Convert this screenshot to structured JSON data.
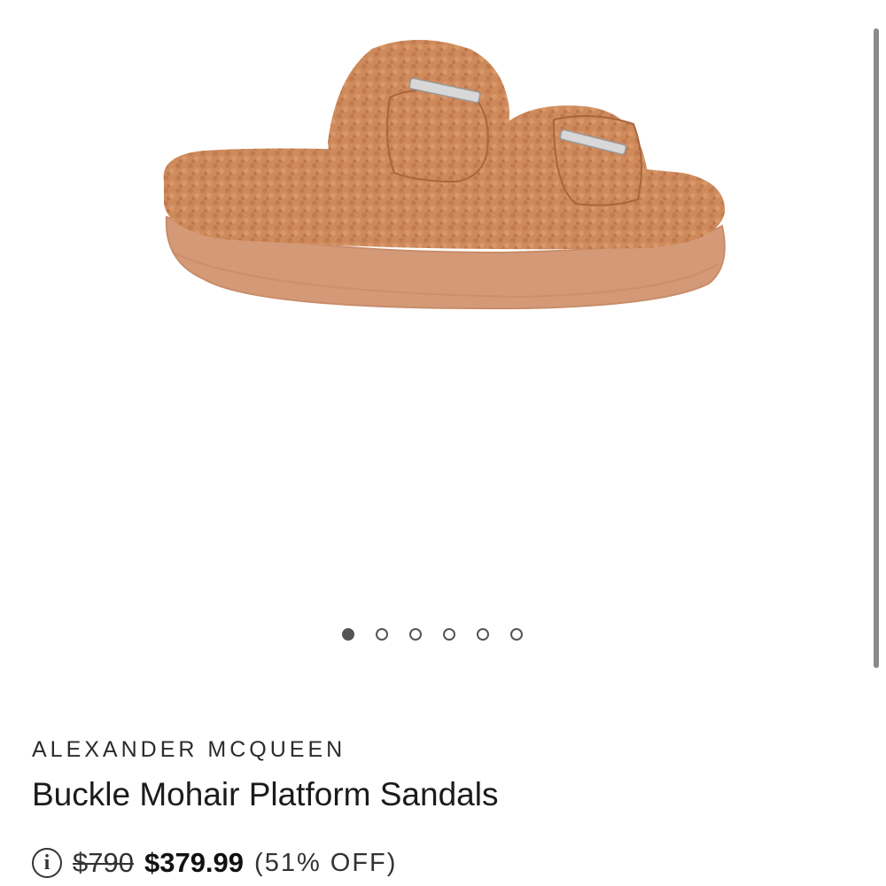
{
  "product": {
    "brand": "ALEXANDER MCQUEEN",
    "name": "Buckle Mohair Platform Sandals",
    "price": {
      "original": "$790",
      "sale": "$379.99",
      "discount": "(51% OFF)"
    },
    "image_alt_colors": {
      "sole": "#d49a78",
      "fur": "#cf8a5c",
      "fur_shadow": "#b56f45",
      "buckle": "#d8d8d8"
    }
  },
  "gallery": {
    "total_images": 6,
    "active_index": 0
  },
  "icons": {
    "info": "info-icon"
  }
}
